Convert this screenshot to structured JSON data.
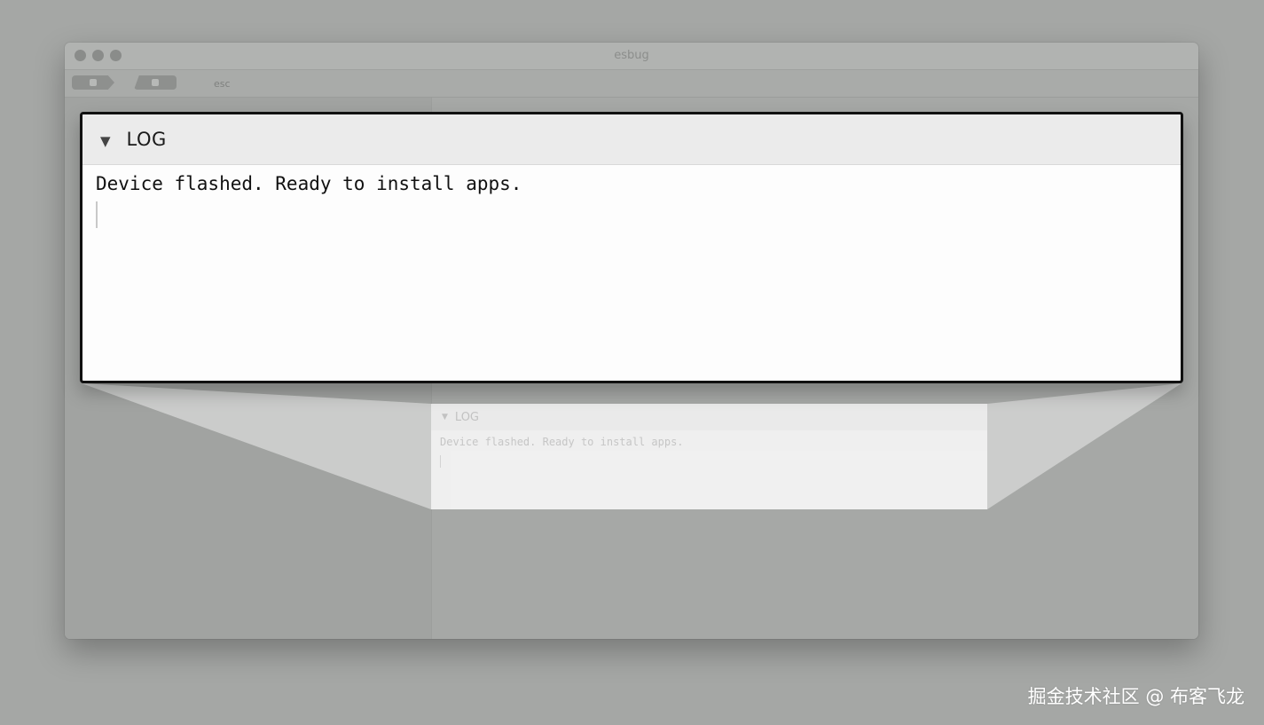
{
  "window": {
    "title": "esbug"
  },
  "toolbar": {
    "label": "esc"
  },
  "log_panel": {
    "title": "LOG",
    "collapse_glyph": "▼",
    "message": "Device flashed. Ready to install apps."
  },
  "watermark": {
    "text": "掘金技术社区 @ 布客飞龙"
  },
  "colors": {
    "background": "#a5a7a5",
    "panel_bg": "#fdfdfd",
    "panel_border": "#111111"
  }
}
